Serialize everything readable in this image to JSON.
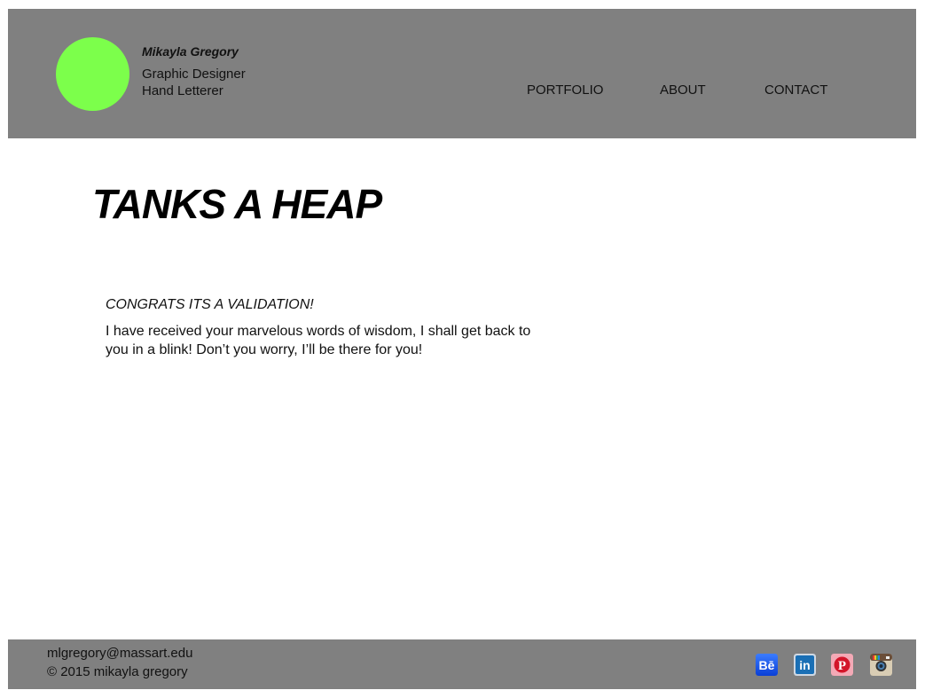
{
  "header": {
    "name": "Mikayla Gregory",
    "role_line1": "Graphic Designer",
    "role_line2": "Hand Letterer",
    "nav": [
      {
        "label": "PORTFOLIO"
      },
      {
        "label": "ABOUT"
      },
      {
        "label": "CONTACT"
      }
    ],
    "logo_color": "#7cff4b",
    "bar_color": "#808080"
  },
  "main": {
    "title": "TANKS A HEAP",
    "heading": "CONGRATS ITS A VALIDATION!",
    "body": "I have received your marvelous words of wisdom, I shall get back to you in a blink! Don’t you worry, I’ll be there for you!"
  },
  "footer": {
    "email": "mlgregory@massart.edu",
    "copyright": "© 2015 mikayla gregory",
    "social_icons": [
      "behance-icon",
      "linkedin-icon",
      "pinterest-icon",
      "instagram-icon"
    ]
  }
}
